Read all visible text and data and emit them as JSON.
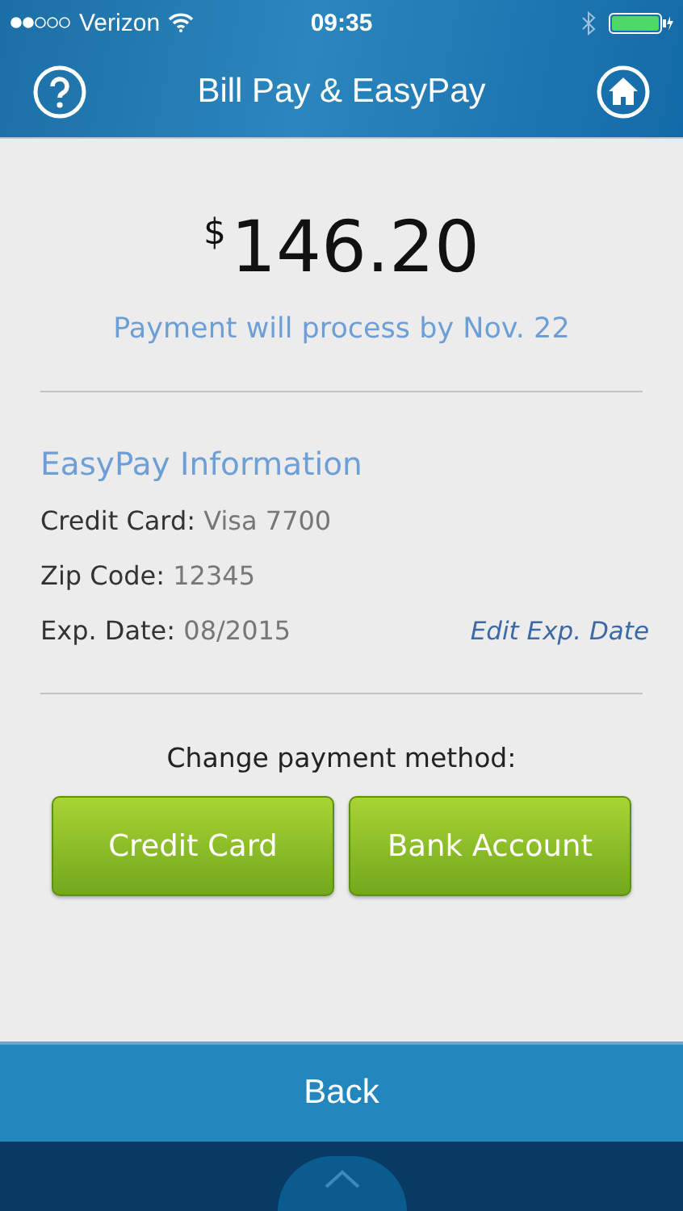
{
  "status_bar": {
    "carrier": "Verizon",
    "time": "09:35"
  },
  "nav": {
    "title": "Bill Pay & EasyPay"
  },
  "payment": {
    "currency": "$",
    "amount": "146.20",
    "note": "Payment will process by Nov. 22"
  },
  "easypay": {
    "heading": "EasyPay Information",
    "fields": [
      {
        "label": "Credit Card:",
        "value": "Visa 7700"
      },
      {
        "label": "Zip Code:",
        "value": "12345"
      },
      {
        "label": "Exp. Date:",
        "value": "08/2015",
        "action": "Edit Exp. Date"
      }
    ]
  },
  "change_method": {
    "label": "Change payment method:",
    "buttons": [
      "Credit Card",
      "Bank Account"
    ]
  },
  "back_button": "Back"
}
